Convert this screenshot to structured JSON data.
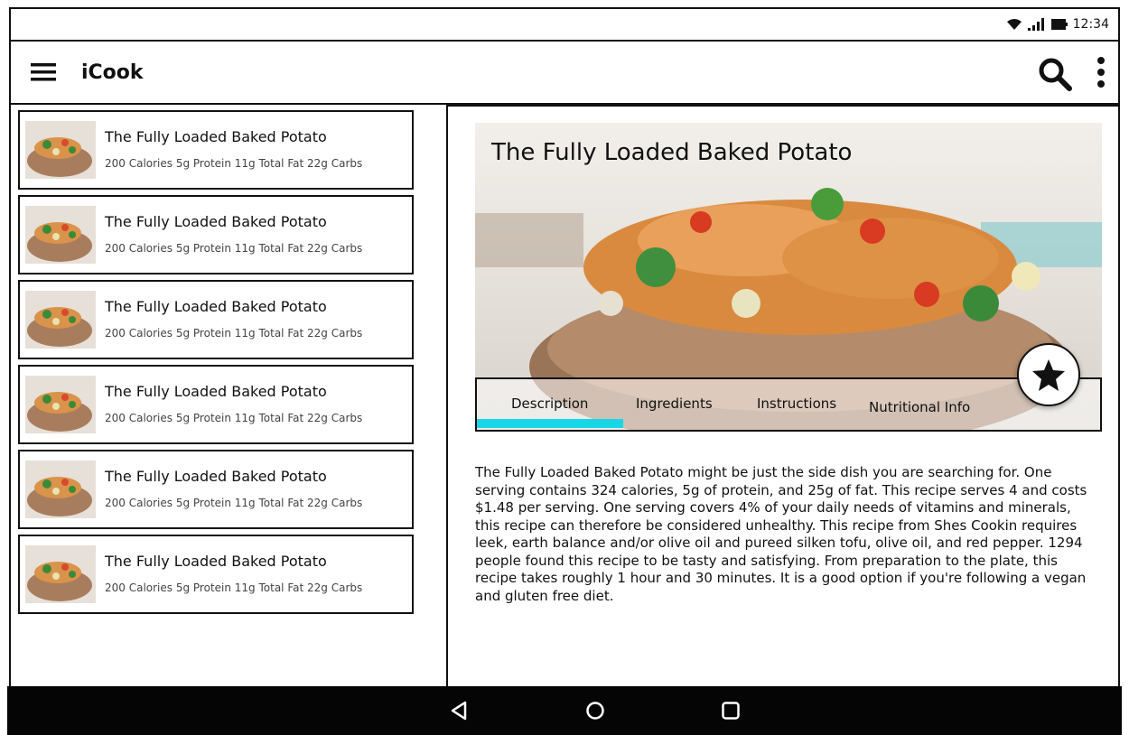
{
  "status_bar": {
    "time": "12:34",
    "icons": [
      "wifi-icon",
      "signal-icon",
      "battery-icon"
    ]
  },
  "app_bar": {
    "title": "iCook",
    "icons": [
      "menu-icon",
      "search-icon",
      "more-vert-icon"
    ]
  },
  "recipes": [
    {
      "title": "The Fully Loaded Baked Potato",
      "meta": "200 Calories 5g Protein 11g Total Fat 22g Carbs"
    },
    {
      "title": "The Fully Loaded Baked Potato",
      "meta": "200 Calories 5g Protein 11g Total Fat 22g Carbs"
    },
    {
      "title": "The Fully Loaded Baked Potato",
      "meta": "200 Calories 5g Protein 11g Total Fat 22g Carbs"
    },
    {
      "title": "The Fully Loaded Baked Potato",
      "meta": "200 Calories 5g Protein 11g Total Fat 22g Carbs"
    },
    {
      "title": "The Fully Loaded Baked Potato",
      "meta": "200 Calories 5g Protein 11g Total Fat 22g Carbs"
    },
    {
      "title": "The Fully Loaded Baked Potato",
      "meta": "200 Calories 5g Protein 11g Total Fat 22g Carbs"
    }
  ],
  "detail": {
    "title": "The Fully Loaded Baked Potato",
    "tabs": [
      "Description",
      "Ingredients",
      "Instructions",
      "Nutritional Info"
    ],
    "active_tab": "Description",
    "description": "The Fully Loaded Baked Potato might be just the side dish you are searching for. One serving contains 324 calories, 5g of protein, and 25g of fat. This recipe serves 4 and costs $1.48 per serving. One serving covers 4% of your daily needs of vitamins and minerals, this recipe can therefore be considered unhealthy. This recipe from Shes Cookin requires leek, earth balance and/or olive oil and pureed silken tofu, olive oil, and red pepper. 1294 people found this recipe to be tasty and satisfying. From preparation to the plate, this recipe takes roughly 1 hour and 30 minutes. It is a good option if you're following a vegan and gluten free diet."
  },
  "colors": {
    "tab_indicator": "#19d6e6",
    "nav_bar": "#050505"
  },
  "nav_bar": {
    "icons": [
      "back-icon",
      "home-icon",
      "recents-icon"
    ]
  }
}
